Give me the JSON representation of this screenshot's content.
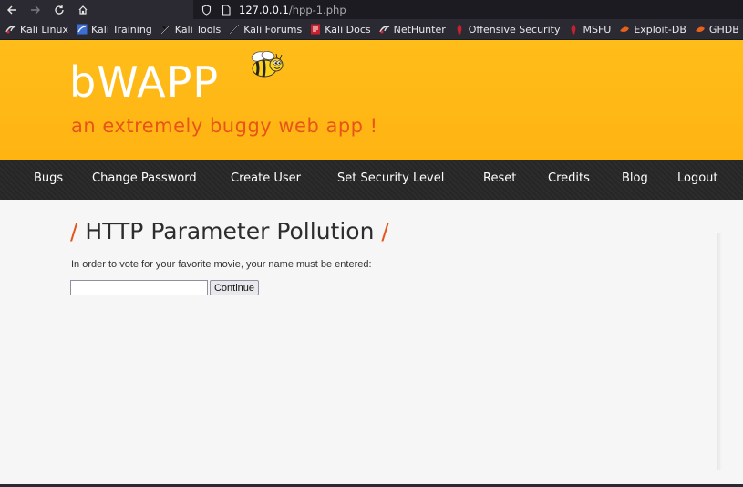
{
  "browser": {
    "url_host": "127.0.0.1",
    "url_path": "/hpp-1.php",
    "bookmarks": [
      {
        "label": "Kali Linux",
        "icon": "kali-dragon-icon"
      },
      {
        "label": "Kali Training",
        "icon": "kali-training-icon"
      },
      {
        "label": "Kali Tools",
        "icon": "kali-tools-icon"
      },
      {
        "label": "Kali Forums",
        "icon": "kali-forums-icon"
      },
      {
        "label": "Kali Docs",
        "icon": "kali-docs-icon"
      },
      {
        "label": "NetHunter",
        "icon": "nethunter-icon"
      },
      {
        "label": "Offensive Security",
        "icon": "offsec-icon"
      },
      {
        "label": "MSFU",
        "icon": "msfu-icon"
      },
      {
        "label": "Exploit-DB",
        "icon": "exploit-db-icon"
      },
      {
        "label": "GHDB",
        "icon": "ghdb-icon"
      }
    ]
  },
  "header": {
    "logo": "bWAPP",
    "tagline": "an extremely buggy web app !"
  },
  "menu": {
    "items": [
      "Bugs",
      "Change Password",
      "Create User",
      "Set Security Level",
      "Reset",
      "Credits",
      "Blog",
      "Logout"
    ]
  },
  "main": {
    "title": "HTTP Parameter Pollution",
    "title_slash": "/",
    "intro": "In order to vote for your favorite movie, your name must be entered:",
    "name_value": "",
    "continue_label": "Continue"
  },
  "colors": {
    "header_bg": "#ffb412",
    "accent": "#e8531a",
    "menu_bg": "#2a2a2a"
  }
}
